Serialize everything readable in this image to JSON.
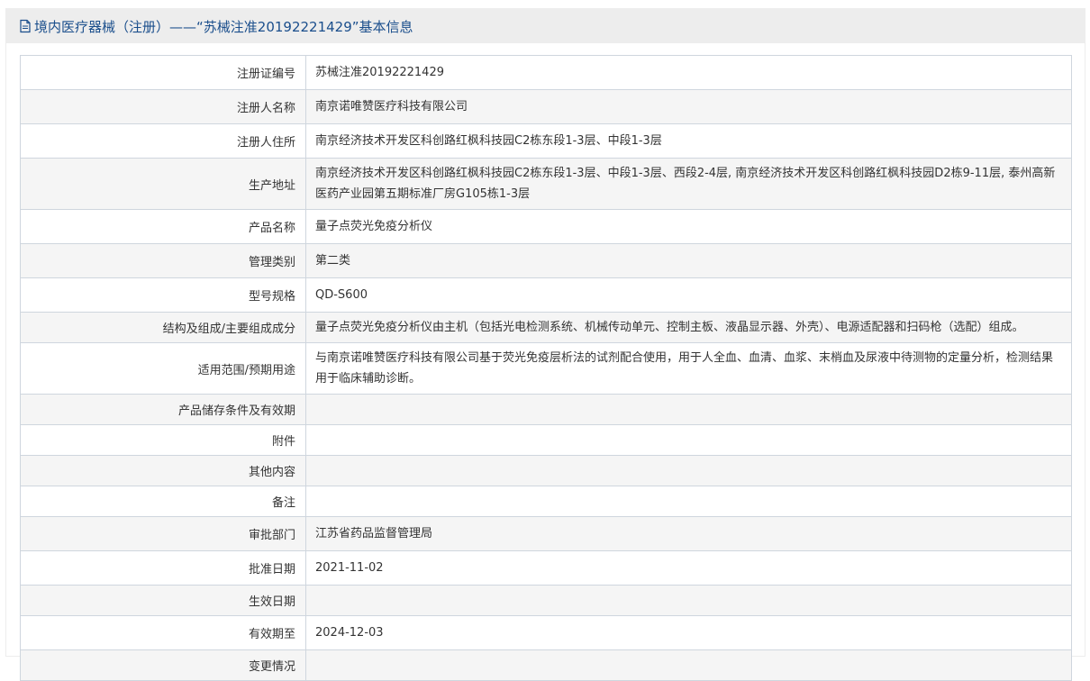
{
  "header": {
    "icon": "document-icon",
    "title": "境内医疗器械（注册）——“苏械注准20192221429”基本信息"
  },
  "rows": [
    {
      "label": "注册证编号",
      "value": "苏械注准20192221429"
    },
    {
      "label": "注册人名称",
      "value": "南京诺唯赞医疗科技有限公司"
    },
    {
      "label": "注册人住所",
      "value": "南京经济技术开发区科创路红枫科技园C2栋东段1-3层、中段1-3层"
    },
    {
      "label": "生产地址",
      "value": "南京经济技术开发区科创路红枫科技园C2栋东段1-3层、中段1-3层、西段2-4层, 南京经济技术开发区科创路红枫科技园D2栋9-11层, 泰州高新医药产业园第五期标准厂房G105栋1-3层"
    },
    {
      "label": "产品名称",
      "value": "量子点荧光免疫分析仪"
    },
    {
      "label": "管理类别",
      "value": "第二类"
    },
    {
      "label": "型号规格",
      "value": "QD-S600"
    },
    {
      "label": "结构及组成/主要组成成分",
      "value": "量子点荧光免疫分析仪由主机（包括光电检测系统、机械传动单元、控制主板、液晶显示器、外壳）、电源适配器和扫码枪（选配）组成。"
    },
    {
      "label": "适用范围/预期用途",
      "value": "与南京诺唯赞医疗科技有限公司基于荧光免疫层析法的试剂配合使用，用于人全血、血清、血浆、末梢血及尿液中待测物的定量分析，检测结果用于临床辅助诊断。"
    },
    {
      "label": "产品储存条件及有效期",
      "value": ""
    },
    {
      "label": "附件",
      "value": ""
    },
    {
      "label": "其他内容",
      "value": ""
    },
    {
      "label": "备注",
      "value": ""
    },
    {
      "label": "审批部门",
      "value": "江苏省药品监督管理局"
    },
    {
      "label": "批准日期",
      "value": "2021-11-02"
    },
    {
      "label": "生效日期",
      "value": ""
    },
    {
      "label": "有效期至",
      "value": "2024-12-03"
    },
    {
      "label": "变更情况",
      "value": ""
    }
  ]
}
